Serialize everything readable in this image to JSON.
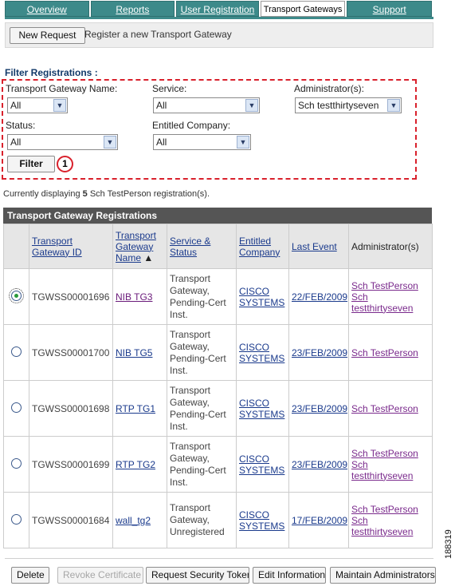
{
  "tabs": [
    {
      "label": "Overview",
      "active": false
    },
    {
      "label": "Reports",
      "active": false
    },
    {
      "label": "User Registration",
      "active": false
    },
    {
      "label": "Transport Gateways",
      "active": true
    },
    {
      "label": "Support",
      "active": false
    }
  ],
  "request_bar": {
    "button_label": "New Request",
    "description": "Register a new Transport Gateway"
  },
  "filter": {
    "heading": "Filter Registrations :",
    "gateway_name_label": "Transport Gateway Name:",
    "gateway_name_value": "All",
    "service_label": "Service:",
    "service_value": "All",
    "administrator_label": "Administrator(s):",
    "administrator_value": "Sch testthirtyseven",
    "status_label": "Status:",
    "status_value": "All",
    "company_label": "Entitled Company:",
    "company_value": "All",
    "button_label": "Filter",
    "callout_number": "1"
  },
  "display": {
    "prefix": "Currently displaying ",
    "count": "5",
    "suffix": " Sch TestPerson registration(s)."
  },
  "table": {
    "title": "Transport Gateway Registrations",
    "headers": {
      "id": "Transport Gateway ID",
      "name": "Transport Gateway Name",
      "sort_indicator": "▲",
      "service": "Service & Status",
      "company": "Entitled Company",
      "last_event": "Last Event",
      "admins": "Administrator(s)"
    },
    "rows": [
      {
        "id": "TGWSS00001696",
        "name": "NIB TG3",
        "service": "Transport Gateway, Pending-Cert Inst.",
        "company": "CISCO SYSTEMS",
        "last_event": "22/FEB/2009",
        "admins": "Sch TestPerson",
        "admins2": "Sch testthirtyseven"
      },
      {
        "id": "TGWSS00001700",
        "name": "NIB TG5",
        "service": "Transport Gateway, Pending-Cert Inst.",
        "company": "CISCO SYSTEMS",
        "last_event": "23/FEB/2009",
        "admins": "Sch TestPerson",
        "admins2": ""
      },
      {
        "id": "TGWSS00001698",
        "name": "RTP TG1",
        "service": "Transport Gateway, Pending-Cert Inst.",
        "company": "CISCO SYSTEMS",
        "last_event": "23/FEB/2009",
        "admins": "Sch TestPerson",
        "admins2": ""
      },
      {
        "id": "TGWSS00001699",
        "name": "RTP TG2",
        "service": "Transport Gateway, Pending-Cert Inst.",
        "company": "CISCO SYSTEMS",
        "last_event": "23/FEB/2009",
        "admins": "Sch TestPerson",
        "admins2": "Sch testthirtyseven"
      },
      {
        "id": "TGWSS00001684",
        "name": "wall_tg2",
        "service": "Transport Gateway, Unregistered",
        "company": "CISCO SYSTEMS",
        "last_event": "17/FEB/2009",
        "admins": "Sch TestPerson",
        "admins2": "Sch testthirtyseven"
      }
    ]
  },
  "actions": {
    "delete": "Delete",
    "revoke": "Revoke Certificate",
    "request_token": "Request Security Token",
    "edit": "Edit Information",
    "maintain": "Maintain Administrators"
  },
  "figure_code": "188319"
}
